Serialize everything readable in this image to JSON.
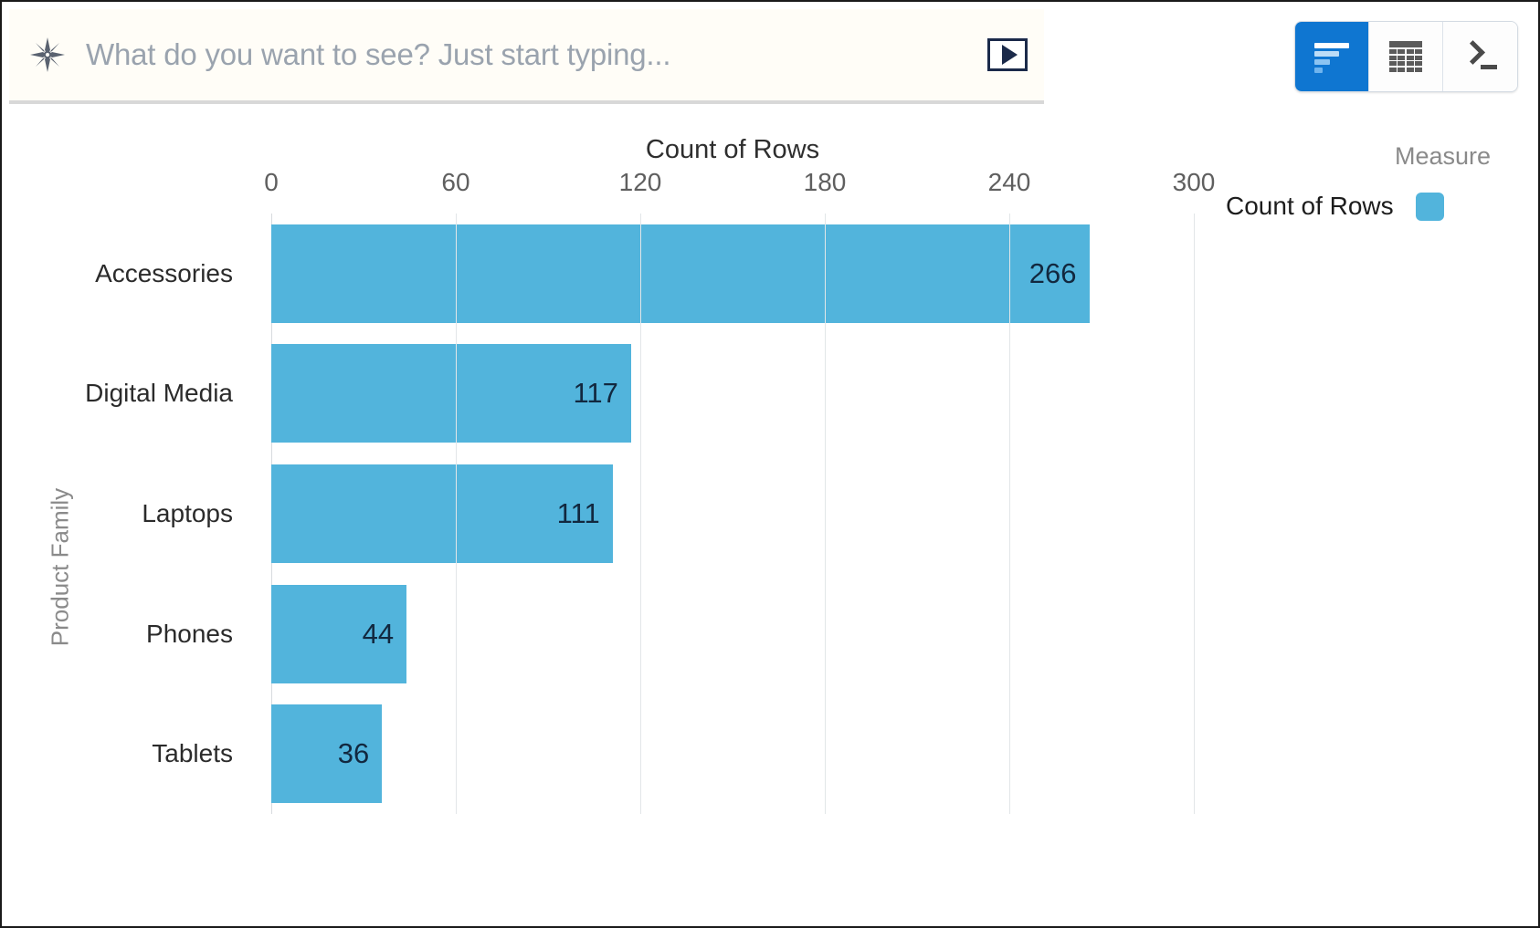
{
  "search": {
    "placeholder": "What do you want to see? Just start typing...",
    "value": "",
    "sparkle_icon": "sparkle-star-icon",
    "run_icon": "play-icon"
  },
  "view_toggle": {
    "buttons": [
      {
        "id": "chart",
        "label": "Chart view",
        "icon": "horizontal-bar-chart-icon",
        "active": true
      },
      {
        "id": "table",
        "label": "Table view",
        "icon": "table-grid-icon",
        "active": false
      },
      {
        "id": "query",
        "label": "Query view",
        "icon": "terminal-prompt-icon",
        "active": false
      }
    ],
    "active_color": "#0f76d1"
  },
  "legend": {
    "title": "Measure",
    "items": [
      {
        "label": "Count of Rows",
        "color": "#52b4dc"
      }
    ]
  },
  "chart_data": {
    "type": "bar",
    "orientation": "horizontal",
    "title": "Count of Rows",
    "xlabel": "Count of Rows",
    "ylabel": "Product Family",
    "categories": [
      "Accessories",
      "Digital Media",
      "Laptops",
      "Phones",
      "Tablets"
    ],
    "values": [
      266,
      117,
      111,
      44,
      36
    ],
    "series": [
      {
        "name": "Count of Rows",
        "color": "#52b4dc",
        "values": [
          266,
          117,
          111,
          44,
          36
        ]
      }
    ],
    "xlim": [
      0,
      300
    ],
    "xticks": [
      0,
      60,
      120,
      180,
      240,
      300
    ],
    "xtick_labels": [
      "0",
      "60",
      "120",
      "180",
      "240",
      "300"
    ],
    "grid": true,
    "grid_axis": "x",
    "legend_position": "right",
    "data_labels": [
      "266",
      "117",
      "111",
      "44",
      "36"
    ]
  }
}
